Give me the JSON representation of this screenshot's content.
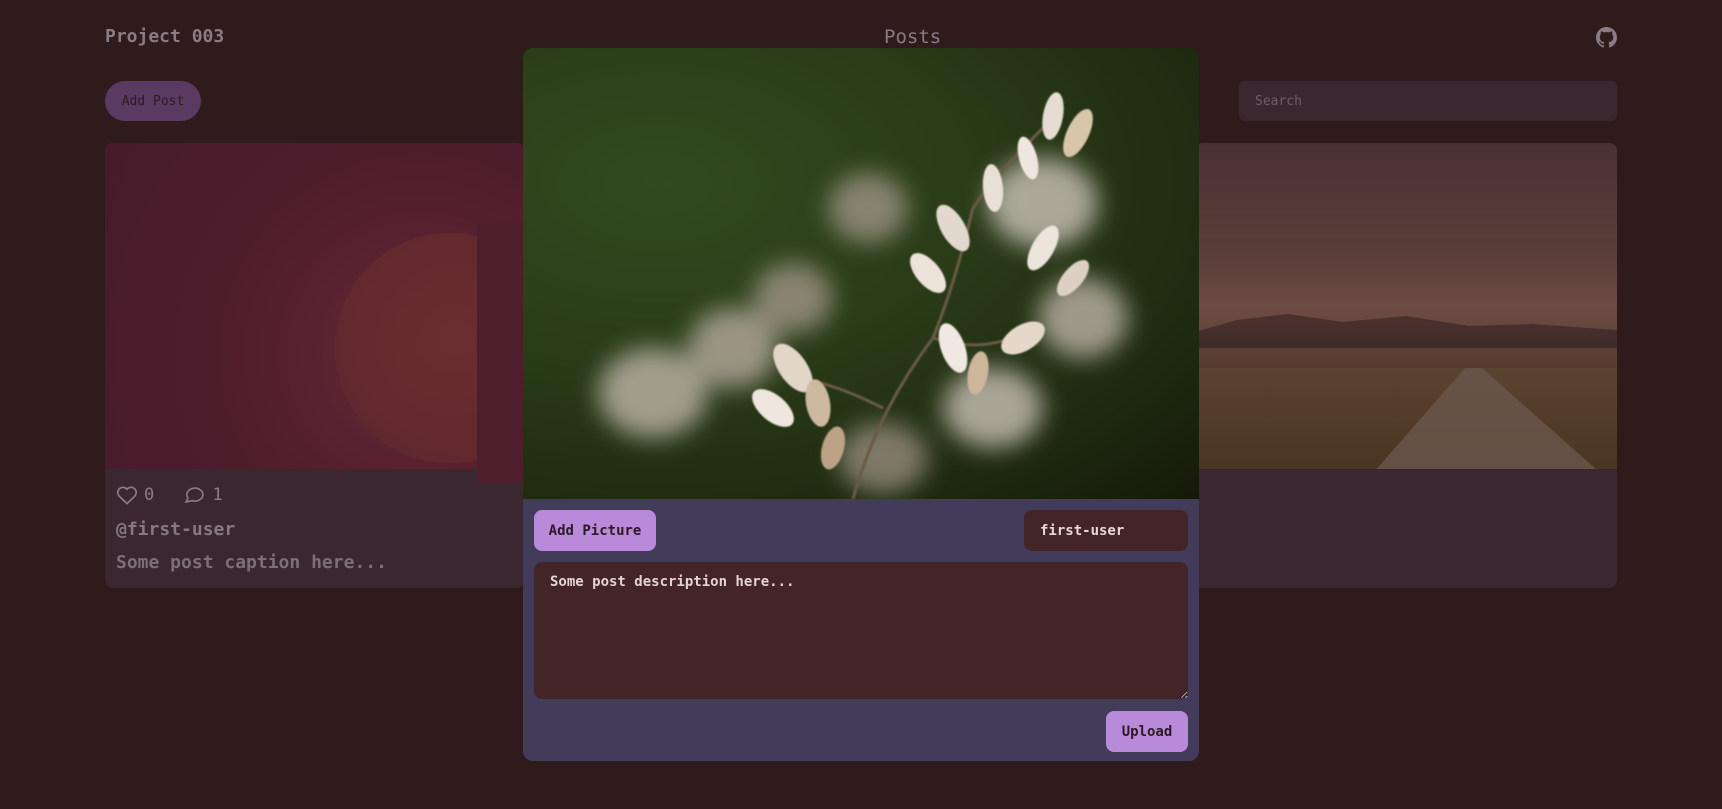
{
  "header": {
    "project_title": "Project 003",
    "page_title": "Posts",
    "github_icon": "github-icon"
  },
  "toolbar": {
    "add_post_label": "Add Post",
    "search_placeholder": "Search"
  },
  "posts": [
    {
      "likes": "0",
      "comments": "1",
      "user": "@first-user",
      "caption": "Some post caption here..."
    }
  ],
  "modal": {
    "add_picture_label": "Add Picture",
    "username_value": "first-user",
    "description_value": "Some post description here...",
    "upload_label": "Upload"
  },
  "colors": {
    "background": "#2f1a1c",
    "modal_panel": "#433b5a",
    "accent_button": "#b98ad9",
    "input_bg": "#442527"
  }
}
